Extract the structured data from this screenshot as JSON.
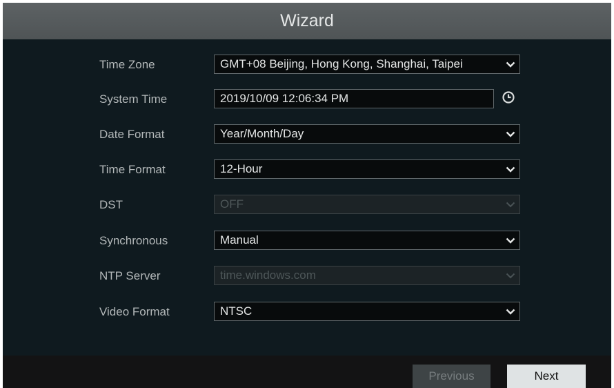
{
  "window": {
    "title": "Wizard"
  },
  "form": {
    "time_zone": {
      "label": "Time Zone",
      "value": "GMT+08 Beijing, Hong Kong, Shanghai, Taipei"
    },
    "system_time": {
      "label": "System Time",
      "value": "2019/10/09 12:06:34 PM"
    },
    "date_format": {
      "label": "Date Format",
      "value": "Year/Month/Day"
    },
    "time_format": {
      "label": "Time Format",
      "value": "12-Hour"
    },
    "dst": {
      "label": "DST",
      "value": "OFF"
    },
    "synchronous": {
      "label": "Synchronous",
      "value": "Manual"
    },
    "ntp_server": {
      "label": "NTP Server",
      "value": "time.windows.com"
    },
    "video_format": {
      "label": "Video Format",
      "value": "NTSC"
    }
  },
  "footer": {
    "previous_label": "Previous",
    "next_label": "Next"
  },
  "icons": {
    "dropdown": "chevron-down-icon",
    "clock": "clock-icon"
  },
  "colors": {
    "titlebar": "#585d5f",
    "background": "#0f1a1f",
    "label": "#b3b8b9",
    "field_border": "#626a6d",
    "next_button": "#dfe3e4",
    "previous_button": "#3e4446"
  }
}
